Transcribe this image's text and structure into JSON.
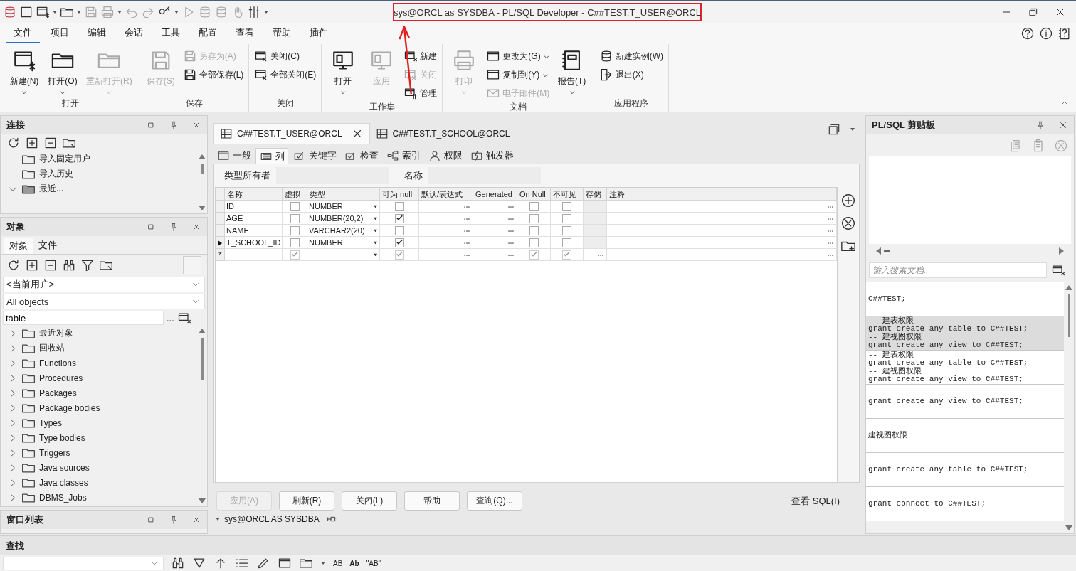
{
  "window": {
    "title": "sys@ORCL as SYSDBA - PL/SQL Developer - C##TEST.T_USER@ORCL"
  },
  "ribbon_tabs": [
    {
      "label": "文件",
      "selected": true
    },
    {
      "label": "项目",
      "selected": false
    },
    {
      "label": "编辑",
      "selected": false
    },
    {
      "label": "会话",
      "selected": false
    },
    {
      "label": "工具",
      "selected": false
    },
    {
      "label": "配置",
      "selected": false
    },
    {
      "label": "查看",
      "selected": false
    },
    {
      "label": "帮助",
      "selected": false
    },
    {
      "label": "插件",
      "selected": false
    }
  ],
  "ribbon_groups": [
    {
      "label": "打开",
      "items": [
        {
          "label": "新建(N)",
          "kind": "large",
          "disabled": false,
          "dropdown": true
        },
        {
          "label": "打开(O)",
          "kind": "large",
          "disabled": false,
          "dropdown": true
        },
        {
          "label": "重新打开(R)",
          "kind": "large",
          "disabled": true,
          "dropdown": true
        }
      ]
    },
    {
      "label": "保存",
      "items": [
        {
          "label": "保存(S)",
          "kind": "large",
          "disabled": true,
          "dropdown": false
        },
        {
          "label": "另存为(A)",
          "kind": "small",
          "disabled": true,
          "dropdown": false
        },
        {
          "label": "全部保存(L)",
          "kind": "small",
          "disabled": false,
          "dropdown": false
        }
      ]
    },
    {
      "label": "关闭",
      "items": [
        {
          "label": "关闭(C)",
          "kind": "small",
          "disabled": false,
          "dropdown": false
        },
        {
          "label": "全部关闭(E)",
          "kind": "small",
          "disabled": false,
          "dropdown": false
        }
      ]
    },
    {
      "label": "工作集",
      "items": [
        {
          "label": "打开",
          "kind": "large",
          "disabled": false,
          "dropdown": true
        },
        {
          "label": "应用",
          "kind": "large",
          "disabled": true,
          "dropdown": false
        },
        {
          "label": "新建",
          "kind": "small",
          "disabled": false,
          "dropdown": false
        },
        {
          "label": "关闭",
          "kind": "small",
          "disabled": true,
          "dropdown": false
        },
        {
          "label": "管理",
          "kind": "small",
          "disabled": false,
          "dropdown": false
        }
      ]
    },
    {
      "label": "文档",
      "items": [
        {
          "label": "打印",
          "kind": "large",
          "disabled": true,
          "dropdown": true
        },
        {
          "label": "更改为(G)",
          "kind": "small",
          "disabled": false,
          "dropdown": true
        },
        {
          "label": "复制到(Y)",
          "kind": "small",
          "disabled": false,
          "dropdown": true
        },
        {
          "label": "电子邮件(M)",
          "kind": "small",
          "disabled": true,
          "dropdown": false
        },
        {
          "label": "报告(T)",
          "kind": "large",
          "disabled": false,
          "dropdown": true
        }
      ]
    },
    {
      "label": "应用程序",
      "items": [
        {
          "label": "新建实例(W)",
          "kind": "small",
          "disabled": false,
          "dropdown": false
        },
        {
          "label": "退出(X)",
          "kind": "small",
          "disabled": false,
          "dropdown": false
        }
      ]
    }
  ],
  "connections_panel": {
    "title": "连接",
    "items": [
      {
        "label": "导入固定用户",
        "kind": "leaf"
      },
      {
        "label": "导入历史",
        "kind": "leaf"
      },
      {
        "label": "最近...",
        "kind": "node",
        "expanded": true
      }
    ]
  },
  "objects_panel": {
    "title": "对象",
    "tabs": [
      {
        "label": "对象",
        "selected": true
      },
      {
        "label": "文件",
        "selected": false
      }
    ],
    "owner_select": "<当前用户>",
    "type_select": "All objects",
    "filter": "table",
    "filter_button": "...",
    "tree": [
      {
        "label": "最近对象",
        "expanded": false
      },
      {
        "label": "回收站",
        "expanded": false
      },
      {
        "label": "Functions",
        "expanded": false
      },
      {
        "label": "Procedures",
        "expanded": false
      },
      {
        "label": "Packages",
        "expanded": false
      },
      {
        "label": "Package bodies",
        "expanded": false
      },
      {
        "label": "Types",
        "expanded": false
      },
      {
        "label": "Type bodies",
        "expanded": false
      },
      {
        "label": "Triggers",
        "expanded": false
      },
      {
        "label": "Java sources",
        "expanded": false
      },
      {
        "label": "Java classes",
        "expanded": false
      },
      {
        "label": "DBMS_Jobs",
        "expanded": false
      }
    ]
  },
  "window_list_panel": {
    "title": "窗口列表"
  },
  "editor": {
    "tabs": [
      {
        "label": "C##TEST.T_USER@ORCL",
        "selected": true
      },
      {
        "label": "C##TEST.T_SCHOOL@ORCL",
        "selected": false
      }
    ],
    "sub_tabs": [
      {
        "label": "一般",
        "selected": false
      },
      {
        "label": "列",
        "selected": true
      },
      {
        "label": "关键字",
        "selected": false
      },
      {
        "label": "检查",
        "selected": false
      },
      {
        "label": "索引",
        "selected": false
      },
      {
        "label": "权限",
        "selected": false
      },
      {
        "label": "触发器",
        "selected": false
      }
    ],
    "type_owner_label": "类型所有者",
    "name_label": "名称",
    "columns": [
      "名称",
      "虚拟",
      "类型",
      "可为 null",
      "默认/表达式",
      "Generated",
      "On Null",
      "不可见",
      "存储",
      "注释"
    ],
    "rows": [
      {
        "kind": "row",
        "name": "ID",
        "virtual": false,
        "type": "NUMBER",
        "nullable": false,
        "on_null": false,
        "invisible": false,
        "selected": false
      },
      {
        "kind": "row",
        "name": "AGE",
        "virtual": false,
        "type": "NUMBER(20,2)",
        "nullable": true,
        "on_null": false,
        "invisible": false,
        "selected": false
      },
      {
        "kind": "row",
        "name": "NAME",
        "virtual": false,
        "type": "VARCHAR2(20)",
        "nullable": false,
        "on_null": false,
        "invisible": false,
        "selected": false
      },
      {
        "kind": "row",
        "name": "T_SCHOOL_ID",
        "virtual": false,
        "type": "NUMBER",
        "nullable": true,
        "on_null": false,
        "invisible": false,
        "selected": true
      },
      {
        "kind": "new",
        "marker": "*",
        "virtual": true,
        "nullable": true,
        "on_null": true,
        "invisible": true,
        "selected": false
      }
    ],
    "buttons": [
      {
        "label": "应用(A)",
        "disabled": true
      },
      {
        "label": "刷新(R)",
        "disabled": false
      },
      {
        "label": "关闭(L)",
        "disabled": false
      },
      {
        "label": "帮助",
        "disabled": false
      },
      {
        "label": "查询(Q)...",
        "disabled": false
      }
    ],
    "view_sql": "查看 SQL(I)",
    "status": "sys@ORCL AS SYSDBA"
  },
  "clipboard_panel": {
    "title": "PL/SQL 剪贴板",
    "search_placeholder": "输入搜索文档..",
    "entries": [
      {
        "lines": [
          "C##TEST;"
        ],
        "selected": false
      },
      {
        "lines": [
          "-- 建表权限",
          "grant create any table to C##TEST;",
          "-- 建视图权限",
          "grant create any view to C##TEST;"
        ],
        "selected": true
      },
      {
        "lines": [
          "-- 建表权限",
          "grant create any table to C##TEST;",
          "-- 建视图权限",
          "grant create any view to C##TEST;"
        ],
        "selected": false
      },
      {
        "lines": [
          "grant create any view to C##TEST;"
        ],
        "selected": false
      },
      {
        "lines": [
          "建视图权限"
        ],
        "selected": false
      },
      {
        "lines": [
          "grant create any table to C##TEST;"
        ],
        "selected": false
      },
      {
        "lines": [
          "grant connect to C##TEST;"
        ],
        "selected": false
      }
    ]
  },
  "find_panel": {
    "title": "查找",
    "toolbar_labels": [
      "AB",
      "Ab",
      "\"AB\""
    ]
  }
}
